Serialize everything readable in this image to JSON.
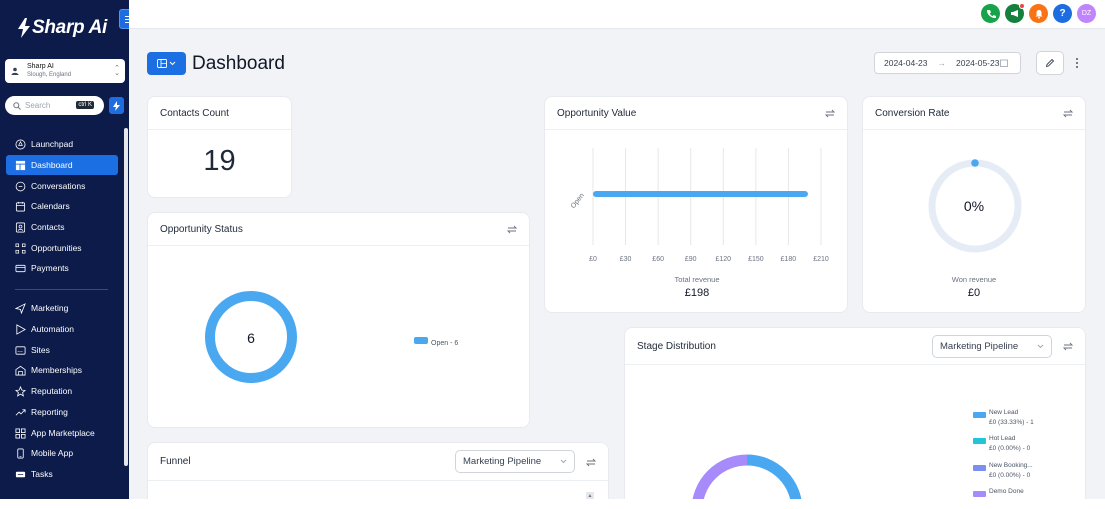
{
  "brand": {
    "name": "Sharp Ai"
  },
  "account": {
    "name": "Sharp AI",
    "location": "Slough, England"
  },
  "search": {
    "placeholder": "Search",
    "shortcut": "ctrl K"
  },
  "sidebar": {
    "items": [
      {
        "label": "Launchpad",
        "icon": "rocket-icon"
      },
      {
        "label": "Dashboard",
        "icon": "dashboard-icon",
        "active": true
      },
      {
        "label": "Conversations",
        "icon": "chat-icon"
      },
      {
        "label": "Calendars",
        "icon": "calendar-icon"
      },
      {
        "label": "Contacts",
        "icon": "contacts-icon"
      },
      {
        "label": "Opportunities",
        "icon": "opportunities-icon"
      },
      {
        "label": "Payments",
        "icon": "payments-icon"
      },
      {
        "label": "Marketing",
        "icon": "send-icon"
      },
      {
        "label": "Automation",
        "icon": "automation-icon"
      },
      {
        "label": "Sites",
        "icon": "sites-icon"
      },
      {
        "label": "Memberships",
        "icon": "memberships-icon"
      },
      {
        "label": "Reputation",
        "icon": "star-icon"
      },
      {
        "label": "Reporting",
        "icon": "trend-icon"
      },
      {
        "label": "App Marketplace",
        "icon": "grid-icon"
      },
      {
        "label": "Mobile App",
        "icon": "mobile-icon"
      },
      {
        "label": "Tasks",
        "icon": "tasks-icon"
      }
    ]
  },
  "topbar": {
    "icons": [
      {
        "name": "phone-icon",
        "color": "#16a34a"
      },
      {
        "name": "megaphone-icon",
        "color": "#15803d"
      },
      {
        "name": "bell-icon",
        "color": "#f97316"
      },
      {
        "name": "help-icon",
        "color": "#1d6ce0"
      }
    ],
    "avatar": {
      "initials": "DZ",
      "color": "#c084fc"
    }
  },
  "header": {
    "title": "Dashboard",
    "date_start": "2024-04-23",
    "date_end": "2024-05-23"
  },
  "cards": {
    "contacts_count": {
      "title": "Contacts Count",
      "value": "19"
    },
    "opportunity_value": {
      "title": "Opportunity Value",
      "xlabel": "Total revenue",
      "total": "£198"
    },
    "conversion_rate": {
      "title": "Conversion Rate",
      "value": "0%",
      "caption": "Won revenue",
      "amount": "£0"
    },
    "opportunity_status": {
      "title": "Opportunity Status",
      "center": "6",
      "legend": "Open - 6"
    },
    "stage_distribution": {
      "title": "Stage Distribution",
      "pipeline": "Marketing Pipeline",
      "legend": [
        {
          "name": "New Lead",
          "value": "£0 (33.33%) - 1",
          "color": "#4aa8f0"
        },
        {
          "name": "Hot Lead",
          "value": "£0 (0.00%) - 0",
          "color": "#22c5d8"
        },
        {
          "name": "New Booking...",
          "value": "£0 (0.00%) - 0",
          "color": "#7c8ff0"
        },
        {
          "name": "Demo Done",
          "value": "",
          "color": "#a78bfa"
        }
      ]
    },
    "funnel": {
      "title": "Funnel",
      "pipeline": "Marketing Pipeline"
    }
  },
  "chart_data": [
    {
      "type": "bar",
      "orientation": "horizontal",
      "categories": [
        "Open"
      ],
      "values": [
        198
      ],
      "xlabel": "Total revenue",
      "xticks": [
        "£0",
        "£30",
        "£60",
        "£90",
        "£120",
        "£150",
        "£180",
        "£210"
      ],
      "xlim": [
        0,
        210
      ],
      "grid": true,
      "color": "#4aa8f0"
    },
    {
      "type": "pie",
      "categories": [
        "Open"
      ],
      "values": [
        6
      ],
      "legend_position": "right",
      "color": "#4aa8f0"
    }
  ]
}
